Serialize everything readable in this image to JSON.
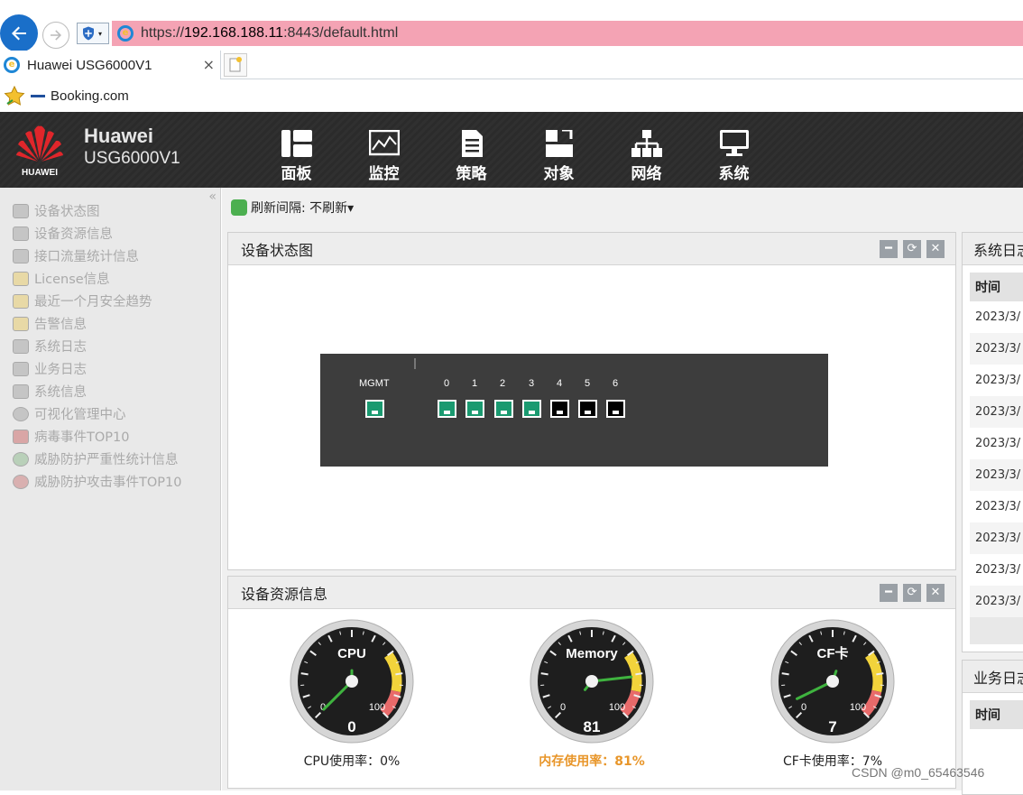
{
  "browser": {
    "url_prefix": "https://",
    "url_host": "192.168.188.11",
    "url_rest": ":8443/default.html",
    "tab_title": "Huawei USG6000V1",
    "tab_close": "×",
    "favorite": "Booking.com"
  },
  "header": {
    "logo_text": "HUAWEI",
    "brand_line1": "Huawei",
    "brand_line2": "USG6000V1",
    "nav": [
      {
        "label": "面板",
        "icon": "dashboard-icon"
      },
      {
        "label": "监控",
        "icon": "monitor-chart-icon"
      },
      {
        "label": "策略",
        "icon": "policy-document-icon"
      },
      {
        "label": "对象",
        "icon": "object-icon"
      },
      {
        "label": "网络",
        "icon": "network-tree-icon"
      },
      {
        "label": "系统",
        "icon": "system-display-icon"
      }
    ]
  },
  "sidebar": {
    "collapse": "«",
    "items": [
      {
        "label": "设备状态图"
      },
      {
        "label": "设备资源信息"
      },
      {
        "label": "接口流量统计信息"
      },
      {
        "label": "License信息"
      },
      {
        "label": "最近一个月安全趋势"
      },
      {
        "label": "告警信息"
      },
      {
        "label": "系统日志"
      },
      {
        "label": "业务日志"
      },
      {
        "label": "系统信息"
      },
      {
        "label": "可视化管理中心"
      },
      {
        "label": "病毒事件TOP10"
      },
      {
        "label": "威胁防护严重性统计信息"
      },
      {
        "label": "威胁防护攻击事件TOP10"
      }
    ]
  },
  "main": {
    "refresh_label": "刷新间隔: 不刷新▾",
    "panel_device_status": {
      "title": "设备状态图",
      "mgmt_label": "MGMT",
      "ports": [
        {
          "label": "0",
          "status": "up"
        },
        {
          "label": "1",
          "status": "up"
        },
        {
          "label": "2",
          "status": "up"
        },
        {
          "label": "3",
          "status": "up"
        },
        {
          "label": "4",
          "status": "down"
        },
        {
          "label": "5",
          "status": "down"
        },
        {
          "label": "6",
          "status": "down"
        }
      ]
    },
    "panel_resources": {
      "title": "设备资源信息",
      "gauges": [
        {
          "name": "CPU",
          "value": 0,
          "value_text": "0",
          "min": "0",
          "max": "100",
          "caption": "CPU使用率：0%",
          "caption_color": "#222222"
        },
        {
          "name": "Memory",
          "value": 81,
          "value_text": "81",
          "min": "0",
          "max": "100",
          "caption": "内存使用率：81%",
          "caption_color": "#e8962a"
        },
        {
          "name": "CF卡",
          "value": 7,
          "value_text": "7",
          "min": "0",
          "max": "100",
          "caption": "CF卡使用率：7%",
          "caption_color": "#222222"
        }
      ]
    },
    "panel_syslog": {
      "title": "系统日志",
      "column": "时间",
      "rows": [
        "2023/3/",
        "2023/3/",
        "2023/3/",
        "2023/3/",
        "2023/3/",
        "2023/3/",
        "2023/3/",
        "2023/3/",
        "2023/3/",
        "2023/3/"
      ]
    },
    "panel_bizlog": {
      "title": "业务日志",
      "column": "时间"
    }
  },
  "watermark": "CSDN @m0_65463546",
  "colors": {
    "accent_green": "#1a9a70",
    "header_bg": "#2b2b2b",
    "url_highlight": "#f4a3b4"
  }
}
